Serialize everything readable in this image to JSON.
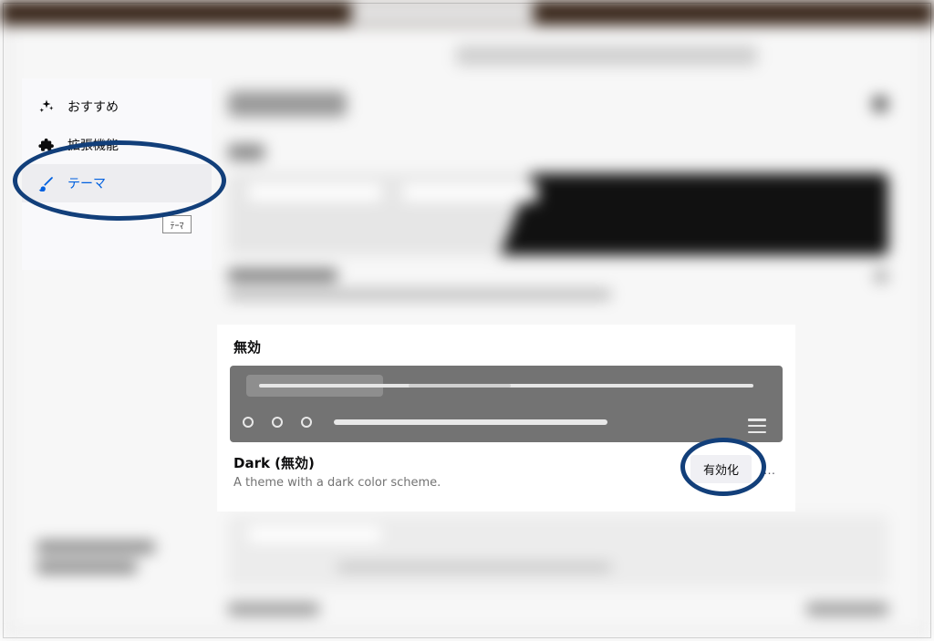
{
  "sidebar": {
    "items": [
      {
        "label": "おすすめ"
      },
      {
        "label": "拡張機能"
      },
      {
        "label": "テーマ"
      }
    ],
    "mini_button": "ﾃｰﾏ"
  },
  "themes": {
    "disabled_section_title": "無効",
    "dark": {
      "name": "Dark (無効)",
      "description": "A theme with a dark color scheme.",
      "enable_label": "有効化",
      "more_label": "…"
    }
  }
}
